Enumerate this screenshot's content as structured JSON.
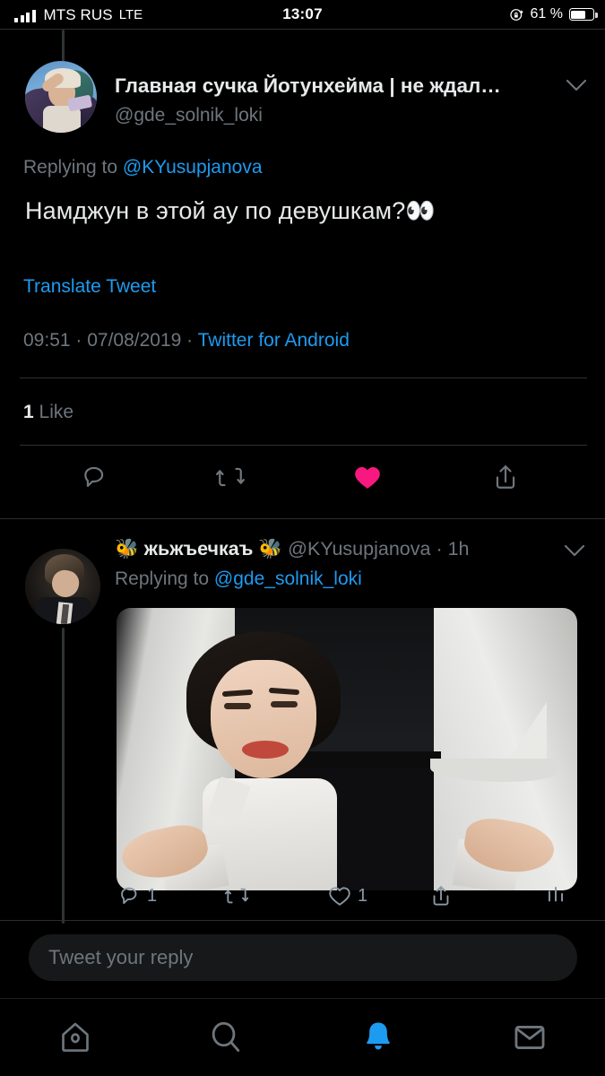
{
  "status_bar": {
    "carrier": "MTS RUS",
    "network": "LTE",
    "time": "13:07",
    "battery_percent": "61 %",
    "signal_icon": "signal-bars-icon",
    "orientation_lock_icon": "rotation-lock-icon",
    "battery_icon": "battery-icon"
  },
  "thread": {
    "main_tweet": {
      "avatar_name": "avatar-gde-solnik-loki",
      "display_name": "Главная сучка Йотунхейма | не ждал…",
      "handle": "@gde_solnik_loki",
      "overflow_icon": "chevron-down-icon",
      "replying_to_label": "Replying to ",
      "replying_to_handle": "@KYusupjanova",
      "text": "Намджун в этой ау по девушкам?👀",
      "translate_label": "Translate Tweet",
      "time": "09:51",
      "date": "07/08/2019",
      "source": "Twitter for Android",
      "meta_separator": " · ",
      "like_count": "1",
      "like_label": "Like",
      "actions": [
        {
          "name": "reply-button",
          "icon": "reply-icon",
          "count": ""
        },
        {
          "name": "retweet-button",
          "icon": "retweet-icon",
          "count": ""
        },
        {
          "name": "like-button",
          "icon": "heart-filled-icon",
          "count": "",
          "color": "#f91880",
          "active": true
        },
        {
          "name": "share-button",
          "icon": "share-icon",
          "count": ""
        }
      ]
    },
    "reply_tweet": {
      "avatar_name": "avatar-kyusupjanova",
      "display_name": "🐝 жьжъечкаъ 🐝",
      "handle": "@KYusupjanova",
      "timestamp": " · 1h",
      "overflow_icon": "chevron-down-icon",
      "replying_to_label": "Replying to ",
      "replying_to_handle": "@gde_solnik_loki",
      "media_name": "tweet-media-image",
      "actions": [
        {
          "name": "reply-button",
          "icon": "reply-icon",
          "count": "1"
        },
        {
          "name": "retweet-button",
          "icon": "retweet-icon",
          "count": ""
        },
        {
          "name": "like-button",
          "icon": "heart-outline-icon",
          "count": "1"
        },
        {
          "name": "share-button",
          "icon": "share-icon",
          "count": ""
        },
        {
          "name": "analytics-button",
          "icon": "analytics-bars-icon",
          "count": ""
        }
      ]
    }
  },
  "reply_composer": {
    "placeholder": "Tweet your reply"
  },
  "bottom_nav": {
    "items": [
      {
        "name": "nav-home",
        "icon": "home-icon",
        "active": false
      },
      {
        "name": "nav-search",
        "icon": "search-icon",
        "active": false
      },
      {
        "name": "nav-notifications",
        "icon": "bell-icon",
        "active": true
      },
      {
        "name": "nav-messages",
        "icon": "envelope-icon",
        "active": false
      }
    ],
    "active_color": "#1d9bf0",
    "inactive_color": "#6e767d"
  },
  "colors": {
    "background": "#000000",
    "primary_text": "#e7e9ea",
    "secondary_text": "#6e767d",
    "link": "#1d9bf0",
    "like": "#f91880",
    "divider": "#2e3032"
  }
}
